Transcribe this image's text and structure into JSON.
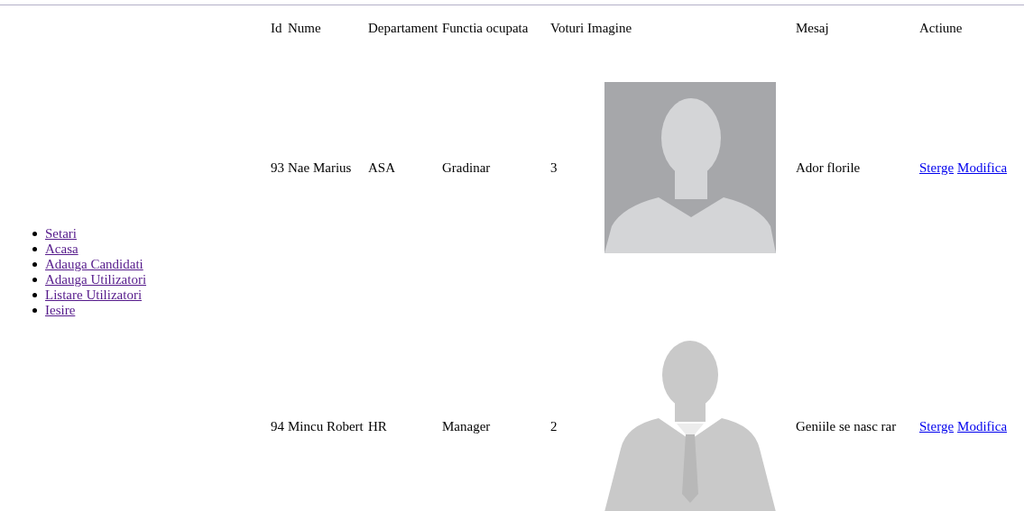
{
  "menu": [
    {
      "label": "Setari"
    },
    {
      "label": "Acasa"
    },
    {
      "label": "Adauga Candidati"
    },
    {
      "label": "Adauga Utilizatori"
    },
    {
      "label": "Listare Utilizatori"
    },
    {
      "label": "Iesire"
    }
  ],
  "table": {
    "columns": [
      "Id",
      "Nume",
      "Departament",
      "Functia ocupata",
      "Voturi",
      "Imagine",
      "Mesaj",
      "Actiune"
    ],
    "rows": [
      {
        "id": "93",
        "name": "Nae Marius",
        "department": "ASA",
        "function": "Gradinar",
        "votes": "3",
        "message": "Ador florile",
        "actions": [
          "Sterge",
          "Modifica"
        ]
      },
      {
        "id": "94",
        "name": "Mincu Robert",
        "department": "HR",
        "function": "Manager",
        "votes": "2",
        "message": "Geniile se nasc rar",
        "actions": [
          "Sterge",
          "Modifica"
        ]
      }
    ]
  }
}
